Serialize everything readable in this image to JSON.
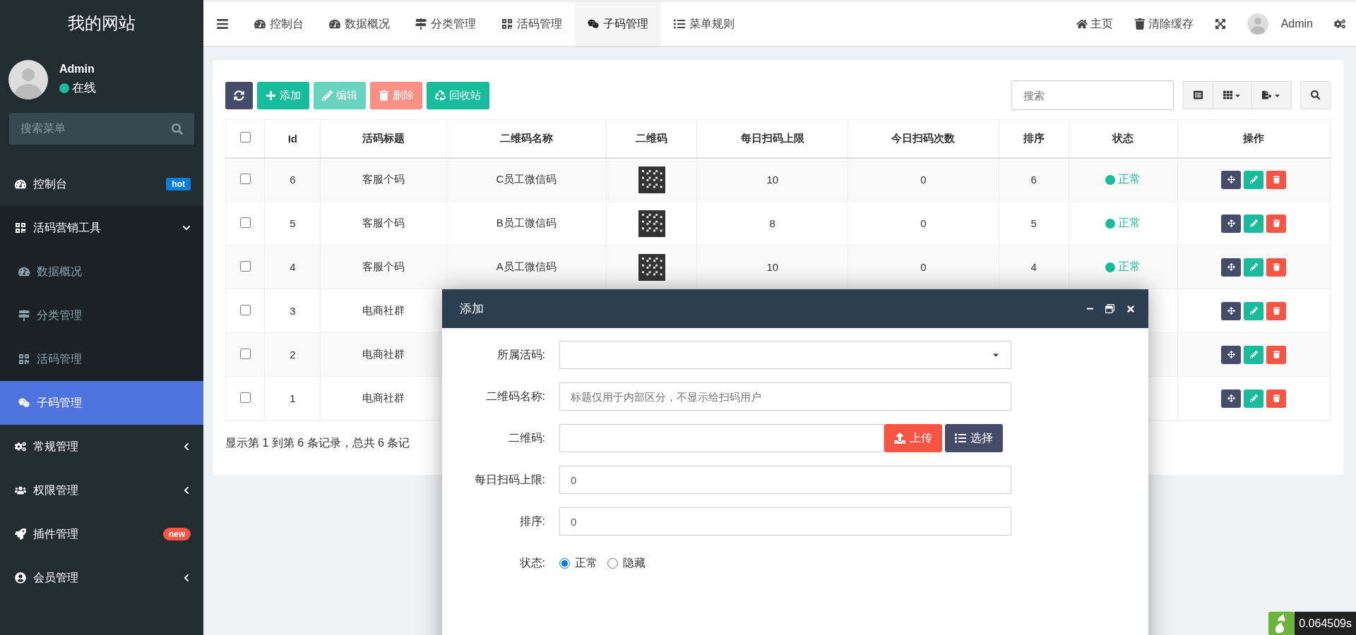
{
  "sidebar": {
    "logo": "我的网站",
    "user": {
      "name": "Admin",
      "status": "在线"
    },
    "search": {
      "placeholder": "搜索菜单"
    },
    "menu": [
      {
        "label": "控制台",
        "selected": false,
        "badge": {
          "text": "hot",
          "color": "#0a7ddb"
        }
      },
      {
        "label": "活码营销工具",
        "selected": false,
        "expanded": true,
        "children": [
          {
            "label": "数据概况",
            "selected": false
          },
          {
            "label": "分类管理",
            "selected": false
          },
          {
            "label": "活码管理",
            "selected": false
          },
          {
            "label": "子码管理",
            "selected": true
          }
        ]
      },
      {
        "label": "常规管理",
        "selected": false,
        "expanded": false
      },
      {
        "label": "权限管理",
        "selected": false,
        "expanded": false
      },
      {
        "label": "插件管理",
        "selected": false,
        "badge": {
          "text": "new",
          "color": "#f75444"
        }
      },
      {
        "label": "会员管理",
        "selected": false,
        "expanded": false
      }
    ]
  },
  "topbar": {
    "tabs": [
      {
        "label": "控制台",
        "selected": false
      },
      {
        "label": "数据概况",
        "selected": false
      },
      {
        "label": "分类管理",
        "selected": false
      },
      {
        "label": "活码管理",
        "selected": false
      },
      {
        "label": "子码管理",
        "selected": true
      },
      {
        "label": "菜单规则",
        "selected": false
      }
    ],
    "links": [
      "主页",
      "清除缓存"
    ],
    "user": "Admin"
  },
  "toolbar": {
    "buttons": [
      {
        "kind": "refresh",
        "disabled": false
      },
      {
        "kind": "add",
        "label": "添加",
        "disabled": false
      },
      {
        "kind": "edit",
        "label": "编辑",
        "disabled": true
      },
      {
        "kind": "delete",
        "label": "删除",
        "disabled": true
      },
      {
        "kind": "recycle",
        "label": "回收站",
        "disabled": false
      }
    ],
    "search": {
      "placeholder": "搜索"
    }
  },
  "table": {
    "all_checked": false,
    "columns": [
      "Id",
      "活码标题",
      "二维码名称",
      "二维码",
      "每日扫码上限",
      "今日扫码次数",
      "排序",
      "状态",
      "操作"
    ],
    "rows": [
      {
        "checked": false,
        "id": "6",
        "title": "客服个码",
        "name": "C员工微信码",
        "limit": "10",
        "today": "0",
        "sort": "6",
        "status": "正常"
      },
      {
        "checked": false,
        "id": "5",
        "title": "客服个码",
        "name": "B员工微信码",
        "limit": "8",
        "today": "0",
        "sort": "5",
        "status": "正常"
      },
      {
        "checked": false,
        "id": "4",
        "title": "客服个码",
        "name": "A员工微信码",
        "limit": "10",
        "today": "0",
        "sort": "4",
        "status": "正常"
      },
      {
        "checked": false,
        "id": "3",
        "title": "电商社群"
      },
      {
        "checked": false,
        "id": "2",
        "title": "电商社群"
      },
      {
        "checked": false,
        "id": "1",
        "title": "电商社群"
      }
    ],
    "footer": "显示第 1 到第 6 条记录，总共 6 条记"
  },
  "dialog": {
    "title": "添加",
    "fields": [
      {
        "kind": "select",
        "label": "所属活码:"
      },
      {
        "kind": "text",
        "label": "二维码名称:",
        "placeholder": "标题仅用于内部区分，不显示给扫码用户"
      },
      {
        "kind": "upload",
        "label": "二维码:",
        "buttons": [
          "上传",
          "选择"
        ]
      },
      {
        "kind": "text",
        "label": "每日扫码上限:",
        "value": "0"
      },
      {
        "kind": "text",
        "label": "排序:",
        "value": "0"
      },
      {
        "kind": "radio",
        "label": "状态:",
        "options": [
          {
            "label": "正常",
            "selected": true
          },
          {
            "label": "隐藏",
            "selected": false
          }
        ]
      }
    ]
  },
  "debug": {
    "time": "0.064509s"
  }
}
